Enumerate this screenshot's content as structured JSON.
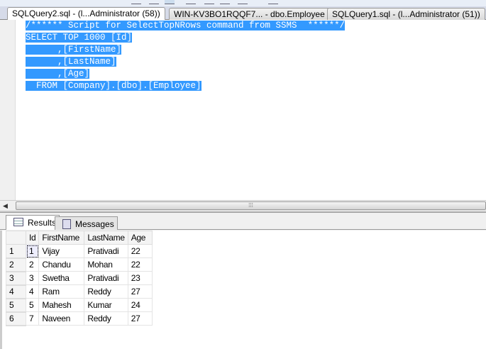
{
  "tabs": [
    {
      "label": "SQLQuery2.sql - (l...Administrator (58))",
      "active": true
    },
    {
      "label": "WIN-KV3BO1RQQF7... - dbo.Employee",
      "active": false
    },
    {
      "label": "SQLQuery1.sql - (l...Administrator (51))",
      "active": false
    }
  ],
  "editor": {
    "lines": [
      "/****** Script for SelectTopNRows command from SSMS  ******/",
      "SELECT TOP 1000 [Id]",
      "      ,[FirstName]",
      "      ,[LastName]",
      "      ,[Age]",
      "  FROM [Company].[dbo].[Employee]"
    ]
  },
  "scrollbar": {
    "grip": "⁞⁞⁞"
  },
  "results": {
    "tabs": [
      {
        "label": "Results"
      },
      {
        "label": "Messages"
      }
    ],
    "columns": [
      "Id",
      "FirstName",
      "LastName",
      "Age"
    ],
    "rows": [
      {
        "n": "1",
        "cells": [
          "1",
          "Vijay",
          "Prativadi",
          "22"
        ]
      },
      {
        "n": "2",
        "cells": [
          "2",
          "Chandu",
          "Mohan",
          "22"
        ]
      },
      {
        "n": "3",
        "cells": [
          "3",
          "Swetha",
          "Prativadi",
          "23"
        ]
      },
      {
        "n": "4",
        "cells": [
          "4",
          "Ram",
          "Reddy",
          "27"
        ]
      },
      {
        "n": "5",
        "cells": [
          "5",
          "Mahesh",
          "Kumar",
          "24"
        ]
      },
      {
        "n": "6",
        "cells": [
          "7",
          "Naveen",
          "Reddy",
          "27"
        ]
      }
    ]
  },
  "colors": {
    "selection": "#3399ff"
  }
}
